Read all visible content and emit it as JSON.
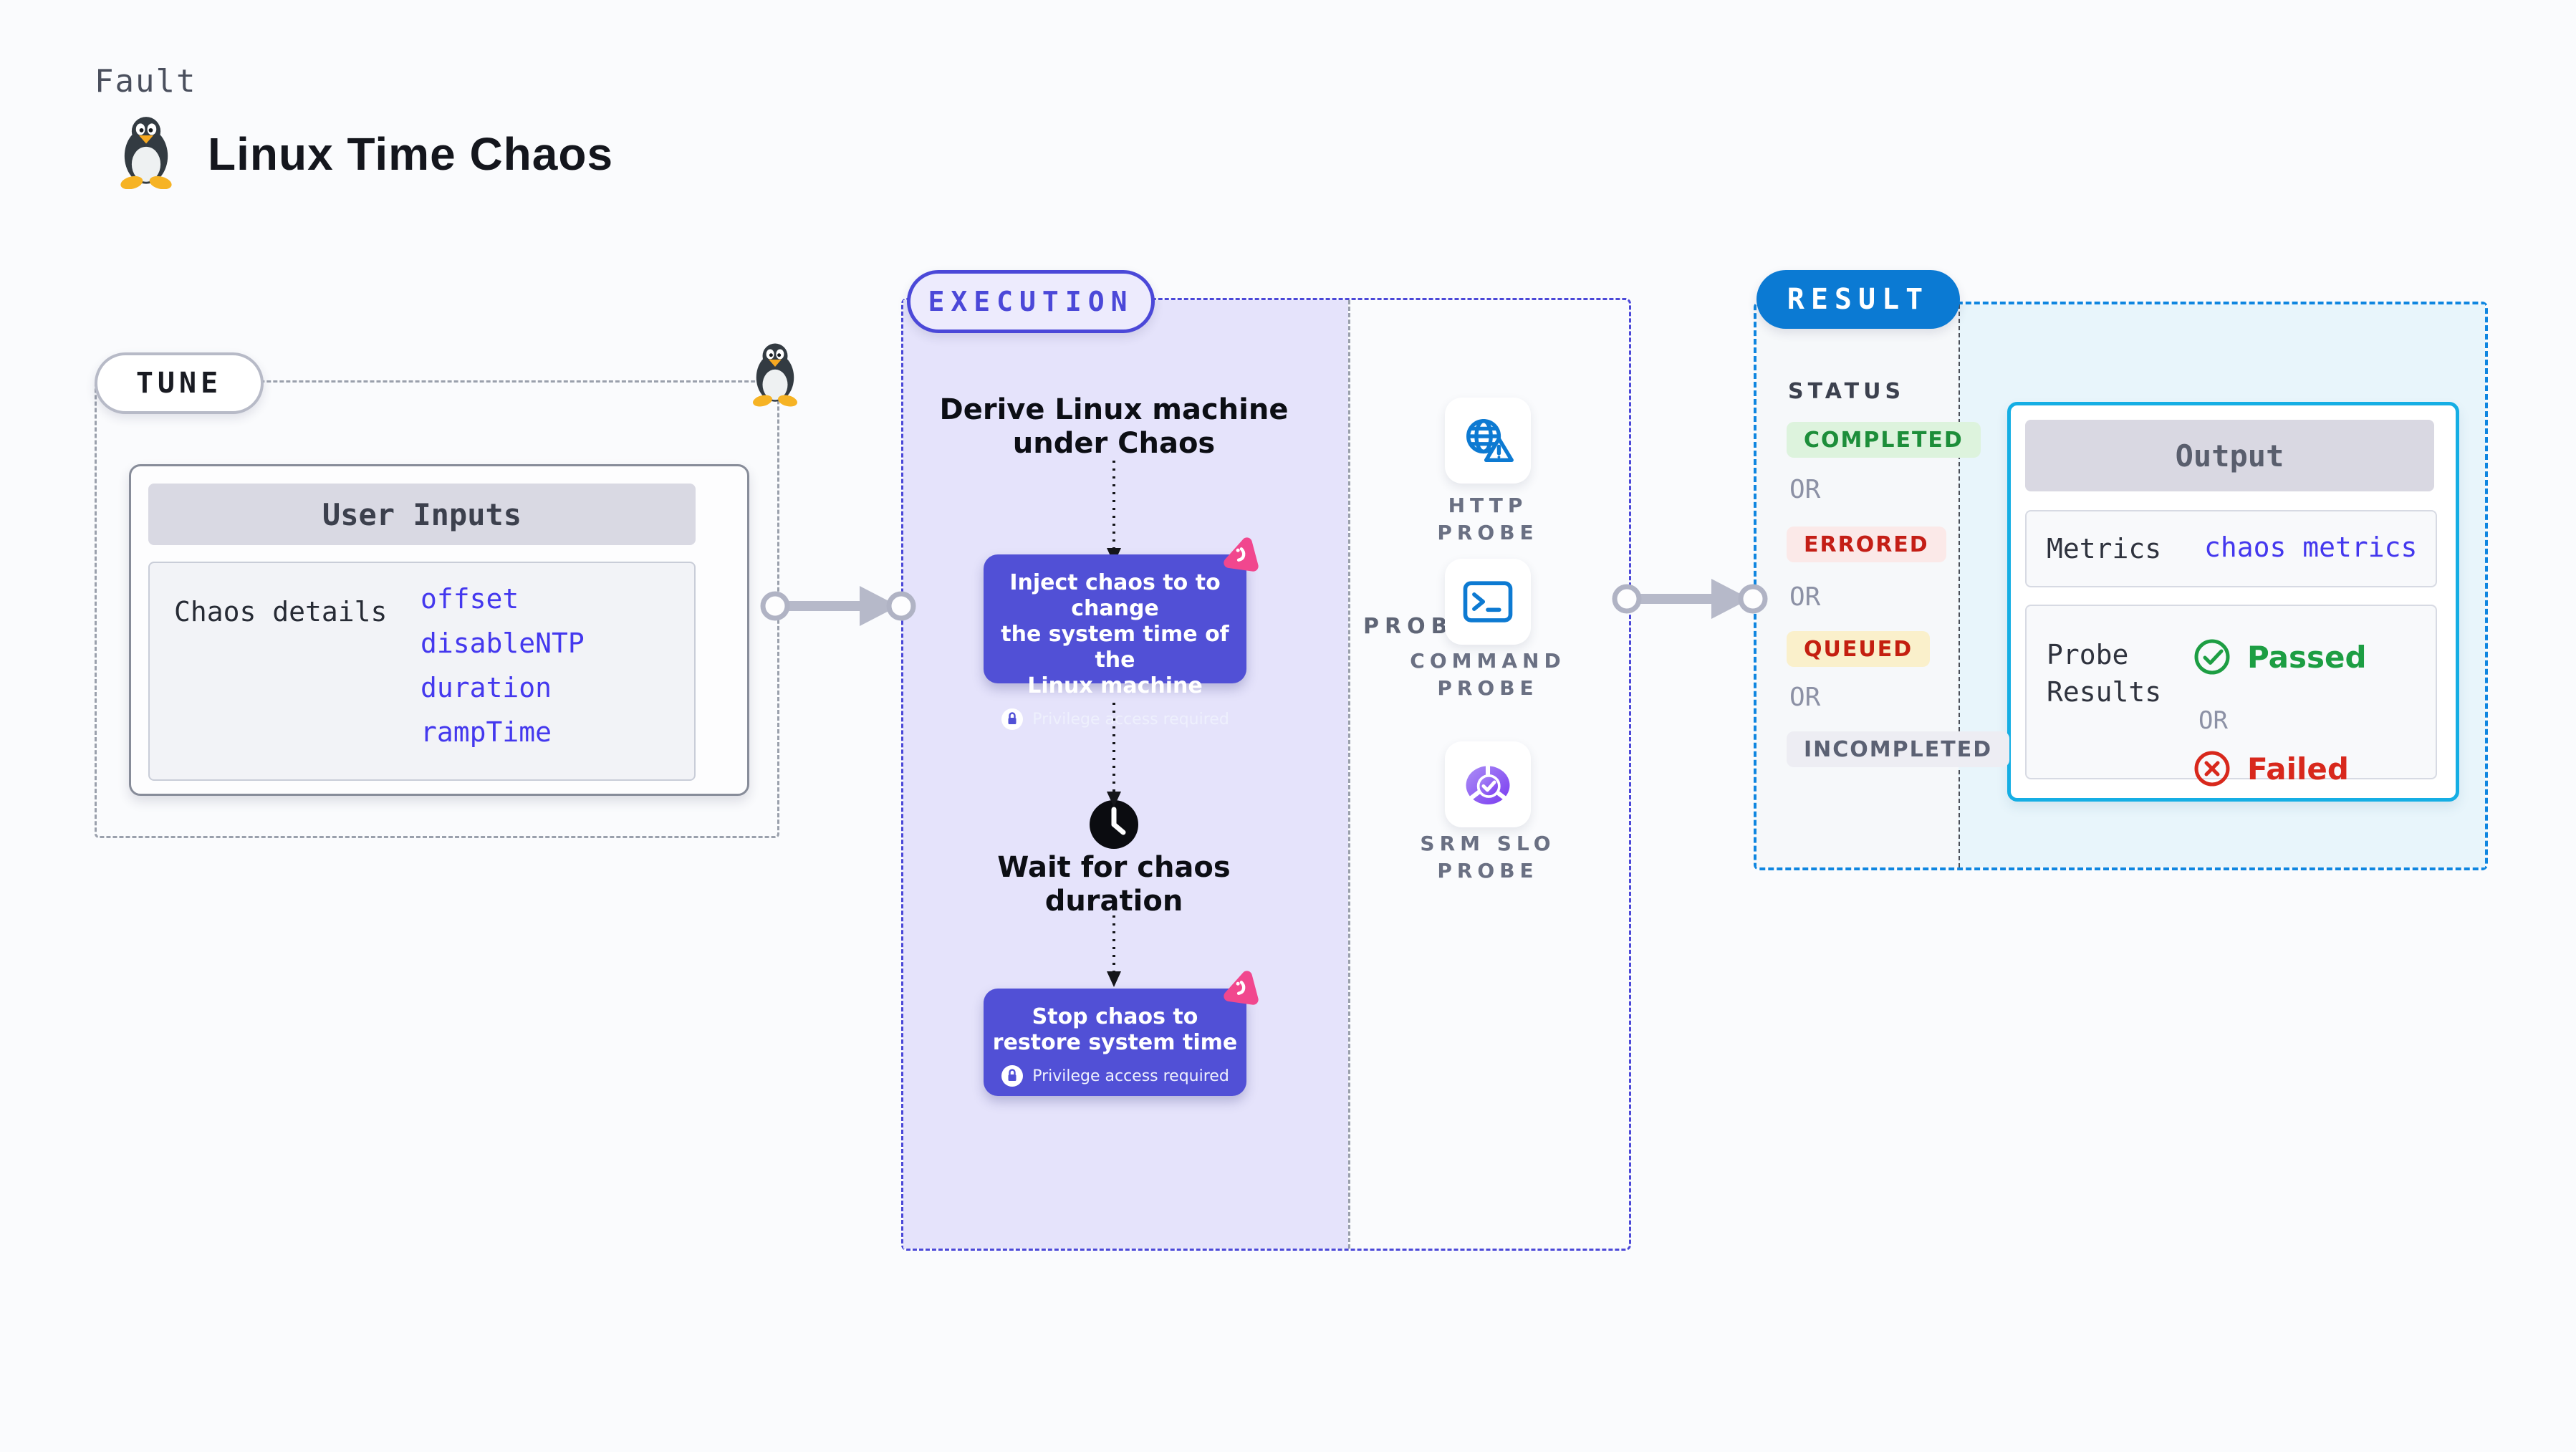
{
  "header": {
    "kicker": "Fault",
    "title": "Linux Time Chaos"
  },
  "tune": {
    "badge": "TUNE",
    "user_inputs": {
      "title": "User Inputs",
      "row_label": "Chaos details",
      "params": [
        "offset",
        "disableNTP",
        "duration",
        "rampTime"
      ]
    }
  },
  "execution": {
    "badge": "EXECUTION",
    "derive_step": "Derive Linux machine\nunder Chaos",
    "inject_step": "Inject chaos to to change\nthe system time of the\nLinux machine",
    "wait_step": "Wait for chaos\nduration",
    "stop_step": "Stop chaos to\nrestore system time",
    "privilege_note": "Privilege access required"
  },
  "probes": {
    "label": "PROBES",
    "items": [
      {
        "label": "HTTP PROBE",
        "icon": "globe-warning-icon"
      },
      {
        "label": "COMMAND PROBE",
        "icon": "terminal-icon"
      },
      {
        "label": "SRM SLO PROBE",
        "icon": "slo-donut-icon"
      }
    ]
  },
  "result": {
    "badge": "RESULT",
    "status": {
      "label": "STATUS",
      "separator": "OR",
      "values": [
        {
          "text": "COMPLETED",
          "fg": "#1d8e3a",
          "bg": "#ddf3dd"
        },
        {
          "text": "ERRORED",
          "fg": "#c41e16",
          "bg": "#fbe9e8"
        },
        {
          "text": "QUEUED",
          "fg": "#c41f10",
          "bg": "#faf0cb"
        },
        {
          "text": "INCOMPLETED",
          "fg": "#5b6173",
          "bg": "#ededf3"
        }
      ]
    },
    "output": {
      "title": "Output",
      "metrics_label": "Metrics",
      "metrics_value": "chaos metrics",
      "probe_results_label": "Probe\nResults",
      "passed": "Passed",
      "separator": "OR",
      "failed": "Failed"
    }
  },
  "colors": {
    "accent_indigo": "#4b48d8",
    "accent_blue": "#0b7ad3",
    "accent_cyan": "#15aee4",
    "node_purple": "#5150d6",
    "param_blue": "#4438ee",
    "probe_icon_blue": "#0d7ad2",
    "passed_green": "#1d9e43",
    "failed_red": "#d8281c",
    "chaos_pink": "#f1478e"
  }
}
